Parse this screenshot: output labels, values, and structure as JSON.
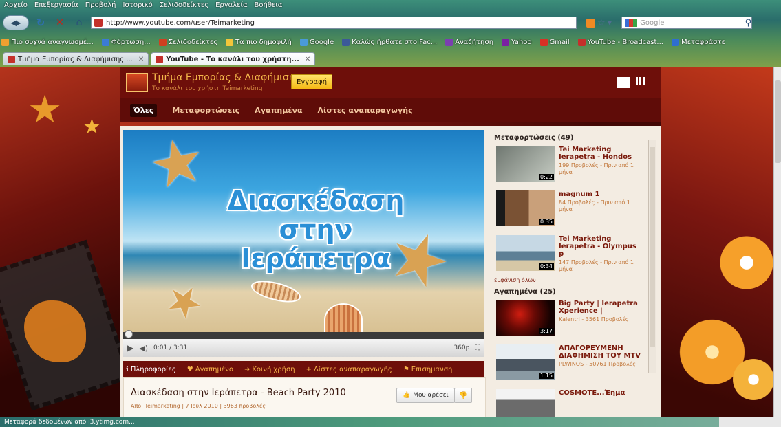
{
  "browser": {
    "menu": [
      "Αρχείο",
      "Επεξεργασία",
      "Προβολή",
      "Ιστορικό",
      "Σελιδοδείκτες",
      "Εργαλεία",
      "Βοήθεια"
    ],
    "url": "http://www.youtube.com/user/Teimarketing",
    "search_placeholder": "Google",
    "bookmarks": [
      "Πιο συχνά αναγνωσμέ...",
      "Φόρτωση...",
      "Σελιδοδείκτες",
      "Τα πιο δημοφιλή",
      "Google",
      "Καλώς ήρθατε στο Fac...",
      "Αναζήτηση",
      "Yahoo",
      "Gmail",
      "YouTube - Broadcast...",
      "Μεταφράστε"
    ],
    "tabs": [
      {
        "label": "Τμήμα Εμπορίας & Διαφήμισης ...",
        "active": false
      },
      {
        "label": "YouTube - Το κανάλι του χρήστη...",
        "active": true
      }
    ],
    "status": "Μεταφορά δεδομένων από i3.ytimg.com..."
  },
  "channel": {
    "name": "Τμήμα Εμπορίας & Διαφήμισης",
    "subtitle": "Το κανάλι του χρήστη Teimarketing",
    "subscribe_label": "Εγγραφή",
    "nav": [
      {
        "label": "Όλες",
        "active": true
      },
      {
        "label": "Μεταφορτώσεις",
        "active": false
      },
      {
        "label": "Αγαπημένα",
        "active": false
      },
      {
        "label": "Λίστες αναπαραγωγής",
        "active": false
      }
    ]
  },
  "player": {
    "video_title_overlay": [
      "Διασκέδαση",
      "στην",
      "Ιεράπετρα"
    ],
    "time": "0:01 / 3:31",
    "quality": "360p",
    "progress_fraction": 0.005
  },
  "actions": [
    {
      "label": "Πληροφορίες",
      "icon": "ℹ",
      "selected": true
    },
    {
      "label": "Αγαπημένο",
      "icon": "♥",
      "selected": false
    },
    {
      "label": "Κοινή χρήση",
      "icon": "➜",
      "selected": false
    },
    {
      "label": "Λίστες αναπαραγωγής",
      "icon": "+",
      "selected": false
    },
    {
      "label": "Επισήμανση",
      "icon": "⚑",
      "selected": false
    }
  ],
  "info": {
    "title": "Διασκέδαση στην Ιεράπετρα - Beach Party 2010",
    "meta": "Από: Teimarketing | 7 Ιουλ 2010 | 3963 προβολές",
    "like_label": "Μου αρέσει"
  },
  "sidebar": {
    "uploads_header": "Μεταφορτώσεις (49)",
    "uploads": [
      {
        "title": "Tei Marketing Ierapetra - Hondos",
        "meta": "199 Προβολές - Πριν από 1 μήνα",
        "duration": "0:22",
        "color": "#8a8f8a"
      },
      {
        "title": "magnum 1",
        "meta": "84 Προβολές - Πριν από 1 μήνα",
        "duration": "0:35",
        "color": "#6b4a2e"
      },
      {
        "title": "Tei Marketing Ierapetra - Olympus p",
        "meta": "147 Προβολές - Πριν από 1 μήνα",
        "duration": "0:34",
        "color": "#9ab3c4"
      }
    ],
    "show_all": "εμφάνιση όλων",
    "favorites_header": "Αγαπημένα (25)",
    "favorites": [
      {
        "title": "Big Party | Ierapetra Xperience |",
        "meta": "Kalentri - 3561 Προβολές",
        "duration": "3:17",
        "color": "#2a0402"
      },
      {
        "title": "ΑΠΑΓΟΡΕΥΜΕΝΗ ΔΙΑΦΗΜΙΣΗ ΤΟΥ MTV",
        "meta": "PLWINOS - 50761 Προβολές",
        "duration": "1:15",
        "color": "#4d5d6a"
      },
      {
        "title": "COSMOTE...Έημα",
        "meta": "",
        "duration": "",
        "color": "#5a5a5a"
      }
    ]
  }
}
